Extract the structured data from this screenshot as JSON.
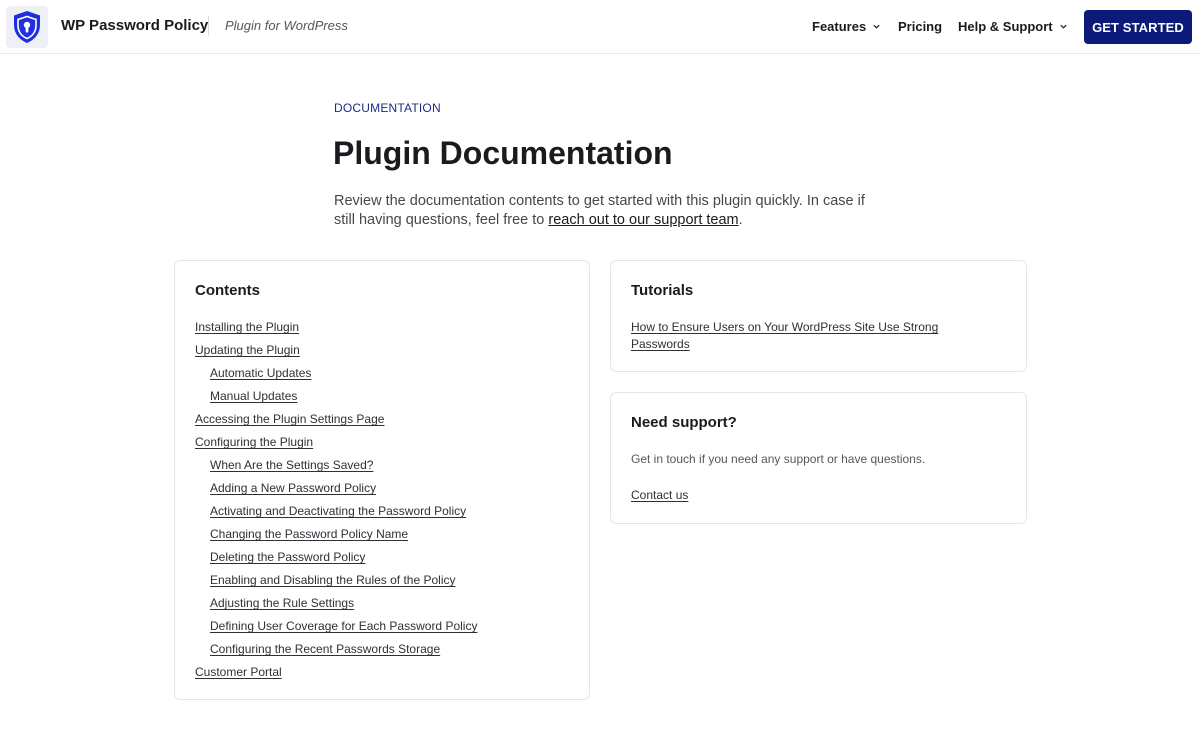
{
  "header": {
    "brand": "WP Password Policy",
    "tagline": "Plugin for WordPress",
    "nav": {
      "features": "Features",
      "pricing": "Pricing",
      "help": "Help & Support"
    },
    "cta": "GET STARTED"
  },
  "intro": {
    "eyebrow": "DOCUMENTATION",
    "title": "Plugin Documentation",
    "text_before": "Review the documentation contents to get started with this plugin quickly. In case if still having questions, feel free to ",
    "link": "reach out to our support team",
    "text_after": "."
  },
  "contents": {
    "title": "Contents",
    "items": [
      {
        "label": "Installing the Plugin",
        "level": 0
      },
      {
        "label": "Updating the Plugin",
        "level": 0
      },
      {
        "label": "Automatic Updates",
        "level": 1
      },
      {
        "label": "Manual Updates",
        "level": 1
      },
      {
        "label": "Accessing the Plugin Settings Page",
        "level": 0
      },
      {
        "label": "Configuring the Plugin",
        "level": 0
      },
      {
        "label": "When Are the Settings Saved?",
        "level": 1
      },
      {
        "label": "Adding a New Password Policy",
        "level": 1
      },
      {
        "label": "Activating and Deactivating the Password Policy",
        "level": 1
      },
      {
        "label": "Changing the Password Policy Name",
        "level": 1
      },
      {
        "label": "Deleting the Password Policy",
        "level": 1
      },
      {
        "label": "Enabling and Disabling the Rules of the Policy",
        "level": 1
      },
      {
        "label": "Adjusting the Rule Settings",
        "level": 1
      },
      {
        "label": "Defining User Coverage for Each Password Policy",
        "level": 1
      },
      {
        "label": "Configuring the Recent Passwords Storage",
        "level": 1
      },
      {
        "label": "Customer Portal",
        "level": 0
      }
    ]
  },
  "tutorials": {
    "title": "Tutorials",
    "link": "How to Ensure Users on Your WordPress Site Use Strong Passwords"
  },
  "support": {
    "title": "Need support?",
    "text": "Get in touch if you need any support or have questions.",
    "link": "Contact us"
  },
  "colors": {
    "accent": "#0c1a7a",
    "logo_shield": "#1f2fe0"
  },
  "icons": {
    "logo": "shield-keyhole-icon",
    "dropdown": "chevron-down-icon"
  }
}
